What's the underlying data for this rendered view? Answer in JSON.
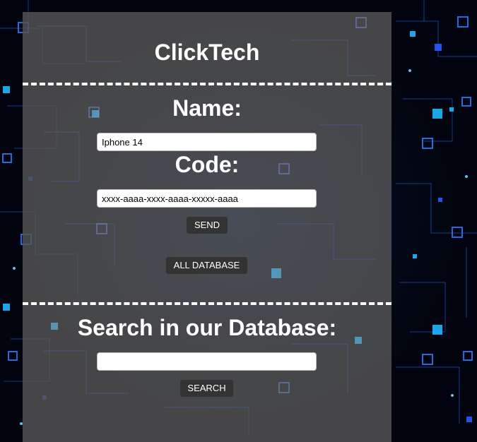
{
  "header": {
    "title": "ClickTech"
  },
  "form": {
    "name_label": "Name:",
    "name_value": "Iphone 14",
    "code_label": "Code:",
    "code_value": "xxxx-aaaa-xxxx-aaaa-xxxxx-aaaa",
    "send_label": "SEND",
    "all_database_label": "ALL DATABASE"
  },
  "search": {
    "heading": "Search in our Database:",
    "value": "",
    "button_label": "SEARCH"
  },
  "colors": {
    "panel": "#565656",
    "button": "#333333",
    "text": "#ffffff",
    "background": "#02050f",
    "circuit_accent": "#1e90ff"
  },
  "icons": {
    "background": "circuit-board-pattern"
  }
}
